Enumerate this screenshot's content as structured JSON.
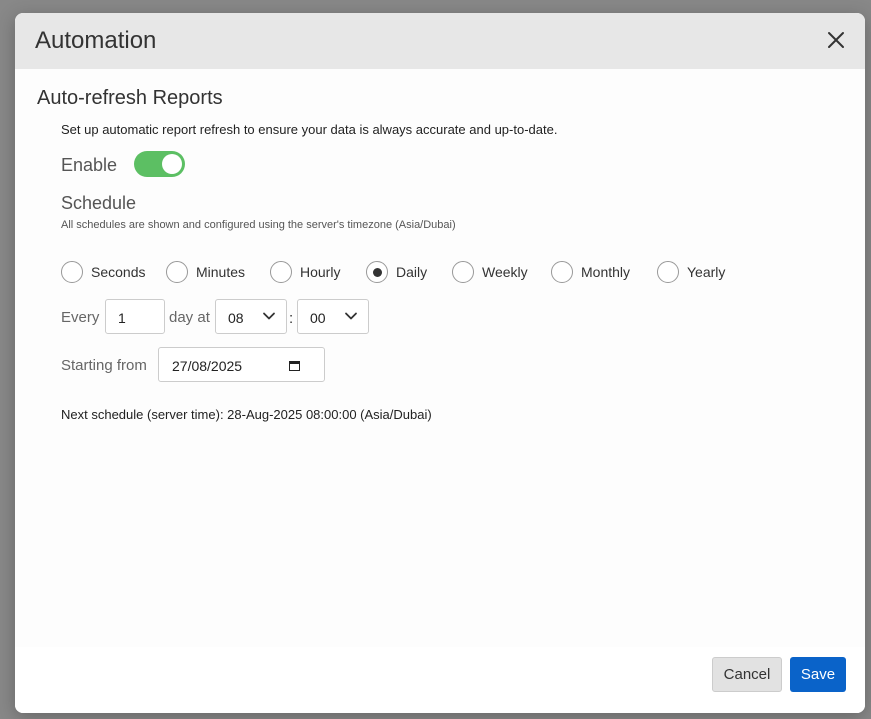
{
  "modal": {
    "title": "Automation"
  },
  "section": {
    "title": "Auto-refresh Reports",
    "description": "Set up automatic report refresh to ensure your data is always accurate and up-to-date."
  },
  "enable": {
    "label": "Enable",
    "on": true,
    "accent": "#5cbf63"
  },
  "schedule": {
    "title": "Schedule",
    "timezone_note": "All schedules are shown and configured using the server's timezone (Asia/Dubai)",
    "frequencies": [
      {
        "label": "Seconds",
        "checked": false
      },
      {
        "label": "Minutes",
        "checked": false
      },
      {
        "label": "Hourly",
        "checked": false
      },
      {
        "label": "Daily",
        "checked": true
      },
      {
        "label": "Weekly",
        "checked": false
      },
      {
        "label": "Monthly",
        "checked": false
      },
      {
        "label": "Yearly",
        "checked": false
      }
    ],
    "every_label": "Every",
    "every_value": "1",
    "day_at_label": "day at",
    "hour": "08",
    "colon": ":",
    "minute": "00",
    "start_label": "Starting from",
    "start_date": "27/08/2025",
    "next_schedule": "Next schedule (server time): 28-Aug-2025 08:00:00 (Asia/Dubai)"
  },
  "footer": {
    "cancel_label": "Cancel",
    "save_label": "Save",
    "save_color": "#0a63c9"
  }
}
